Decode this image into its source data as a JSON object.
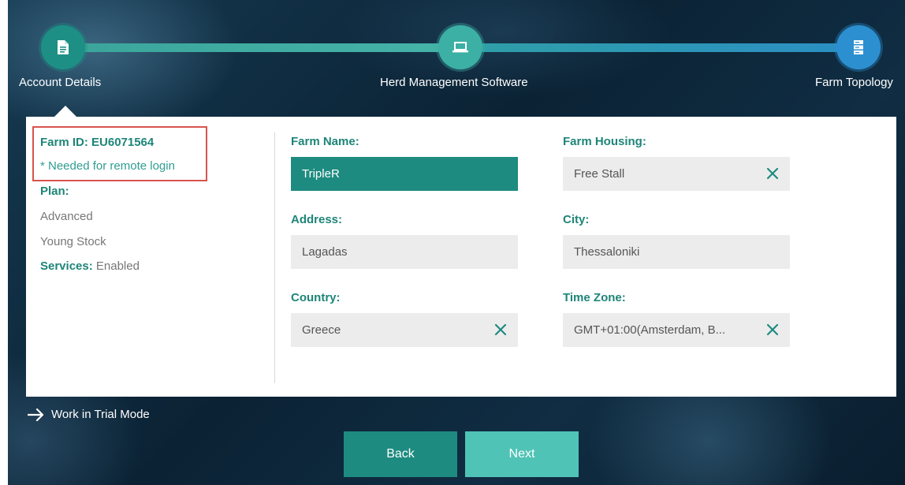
{
  "stepper": {
    "steps": [
      {
        "label": "Account Details",
        "icon": "document-icon"
      },
      {
        "label": "Herd Management Software",
        "icon": "laptop-icon"
      },
      {
        "label": "Farm Topology",
        "icon": "server-icon"
      }
    ]
  },
  "account": {
    "farm_id": "Farm ID: EU6071564",
    "remote_note": "* Needed for remote login",
    "plan_label": "Plan:",
    "plan_items": [
      "Advanced",
      "Young Stock"
    ],
    "services_label": "Services:",
    "services_value": " Enabled"
  },
  "form": {
    "farm_name": {
      "label": "Farm Name:",
      "value": "TripleR"
    },
    "farm_housing": {
      "label": "Farm Housing:",
      "value": "Free Stall"
    },
    "address": {
      "label": "Address:",
      "value": "Lagadas"
    },
    "city": {
      "label": "City:",
      "value": "Thessaloniki"
    },
    "country": {
      "label": "Country:",
      "value": "Greece"
    },
    "time_zone": {
      "label": "Time Zone:",
      "value": "GMT+01:00(Amsterdam, B..."
    }
  },
  "footer": {
    "trial_label": "Work in Trial Mode",
    "back_label": "Back",
    "next_label": "Next"
  },
  "colors": {
    "accent": "#1e8b80",
    "next_button": "#4fc3b6",
    "highlight_border": "#d9534f"
  }
}
